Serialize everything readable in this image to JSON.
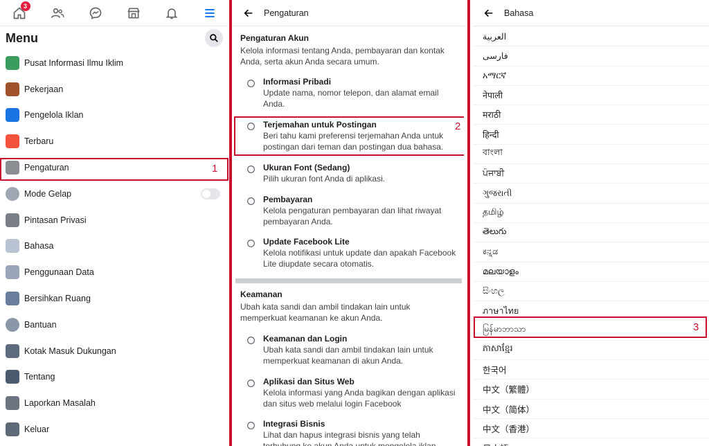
{
  "nav": {
    "badge": "3",
    "icons": [
      "home-icon",
      "friends-icon",
      "messenger-icon",
      "marketplace-icon",
      "bell-icon",
      "hamburger-menu-icon"
    ]
  },
  "menu": {
    "title": "Menu",
    "items": [
      {
        "label": "Pusat Informasi Ilmu Iklim",
        "icon": "climate-icon",
        "color": "#3a9d5d"
      },
      {
        "label": "Pekerjaan",
        "icon": "briefcase-icon",
        "color": "#a0522d"
      },
      {
        "label": "Pengelola Iklan",
        "icon": "ads-manager-icon",
        "color": "#1b74e4"
      },
      {
        "label": "Terbaru",
        "icon": "recent-icon",
        "color": "#f5533d"
      },
      {
        "label": "Pengaturan",
        "icon": "settings-gear-icon",
        "color": "#8a8d91"
      },
      {
        "label": "Mode Gelap",
        "icon": "moon-icon",
        "color": "#a0a7b4"
      },
      {
        "label": "Pintasan Privasi",
        "icon": "lock-icon",
        "color": "#7a7f87"
      },
      {
        "label": "Bahasa",
        "icon": "language-icon",
        "color": "#b9c3d3"
      },
      {
        "label": "Penggunaan Data",
        "icon": "data-usage-icon",
        "color": "#9aa6b8"
      },
      {
        "label": "Bersihkan Ruang",
        "icon": "broom-icon",
        "color": "#6a7e9c"
      },
      {
        "label": "Bantuan",
        "icon": "help-icon",
        "color": "#8a97a8"
      },
      {
        "label": "Kotak Masuk Dukungan",
        "icon": "support-inbox-icon",
        "color": "#5d6b7e"
      },
      {
        "label": "Tentang",
        "icon": "about-icon",
        "color": "#4b5a6e"
      },
      {
        "label": "Laporkan Masalah",
        "icon": "warning-icon",
        "color": "#6b7480"
      },
      {
        "label": "Keluar",
        "icon": "logout-icon",
        "color": "#5f6a78"
      }
    ]
  },
  "annotations": {
    "n1": "1",
    "n2": "2",
    "n3": "3"
  },
  "settings": {
    "title": "Pengaturan",
    "account_section": {
      "title": "Pengaturan Akun",
      "desc": "Kelola informasi tentang Anda, pembayaran dan kontak Anda, serta akun Anda secara umum.",
      "items": [
        {
          "title": "Informasi Pribadi",
          "desc": "Update nama, nomor telepon, dan alamat email Anda.",
          "icon": "user-circle-icon"
        },
        {
          "title": "Terjemahan untuk Postingan",
          "desc": "Beri tahu kami preferensi terjemahan Anda untuk postingan dari teman dan postingan dua bahasa.",
          "icon": "translate-icon"
        },
        {
          "title": "Ukuran Font (Sedang)",
          "desc": "Pilih ukuran font Anda di aplikasi.",
          "icon": "font-size-icon"
        },
        {
          "title": "Pembayaran",
          "desc": "Kelola pengaturan pembayaran dan lihat riwayat pembayaran Anda.",
          "icon": "payment-tag-icon"
        },
        {
          "title": "Update Facebook Lite",
          "desc": "Kelola notifikasi untuk update dan apakah Facebook Lite diupdate secara otomatis.",
          "icon": "facebook-icon"
        }
      ]
    },
    "security_section": {
      "title": "Keamanan",
      "desc": "Ubah kata sandi dan ambil tindakan lain untuk memperkuat keamanan ke akun Anda.",
      "items": [
        {
          "title": "Keamanan dan Login",
          "desc": "Ubah kata sandi dan ambil tindakan lain untuk memperkuat keamanan di akun Anda.",
          "icon": "shield-icon"
        },
        {
          "title": "Aplikasi dan Situs Web",
          "desc": "Kelola informasi yang Anda bagikan dengan aplikasi dan situs web melalui login Facebook",
          "icon": "cube-icon"
        },
        {
          "title": "Integrasi Bisnis",
          "desc": "Lihat dan hapus integrasi bisnis yang telah terhubung ke akun Anda untuk mengelola iklan",
          "icon": "briefcase-outline-icon"
        }
      ]
    }
  },
  "language": {
    "title": "Bahasa",
    "items": [
      "العربية",
      "فارسی",
      "አማርኛ",
      "नेपाली",
      "मराठी",
      "हिन्दी",
      "বাংলা",
      "ਪੰਜਾਬੀ",
      "ગુજરાતી",
      "தமிழ்",
      "తెలుగు",
      "ಕನ್ನಡ",
      "മലയാളം",
      "සිංහල",
      "ภาษาไทย",
      "မြန်မာဘာသာ",
      "ភាសាខ្មែរ",
      "한국어",
      "中文（繁體）",
      "中文（简体）",
      "中文（香港）",
      "日本語"
    ]
  }
}
